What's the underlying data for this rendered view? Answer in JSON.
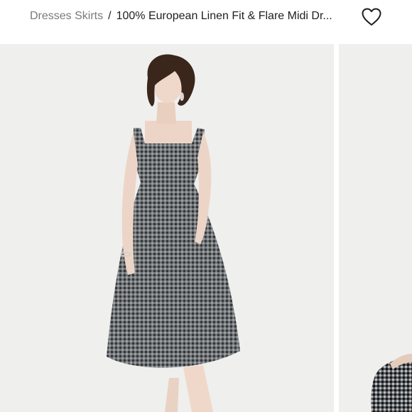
{
  "breadcrumb": {
    "parent_label": "Dresses Skirts",
    "separator": "/",
    "current_label": "100% European Linen Fit & Flare Midi Dr..."
  },
  "favorite": {
    "icon": "heart-outline-icon"
  },
  "gallery": {
    "slides": [
      {
        "name": "model-in-gingham-dress",
        "active": true
      },
      {
        "name": "dress-detail-preview",
        "active": false
      }
    ]
  },
  "colors": {
    "background": "#efefed",
    "breadcrumb_parent": "#7a7a7a",
    "breadcrumb_current": "#1e1e1e",
    "dress": "#6f7376"
  }
}
